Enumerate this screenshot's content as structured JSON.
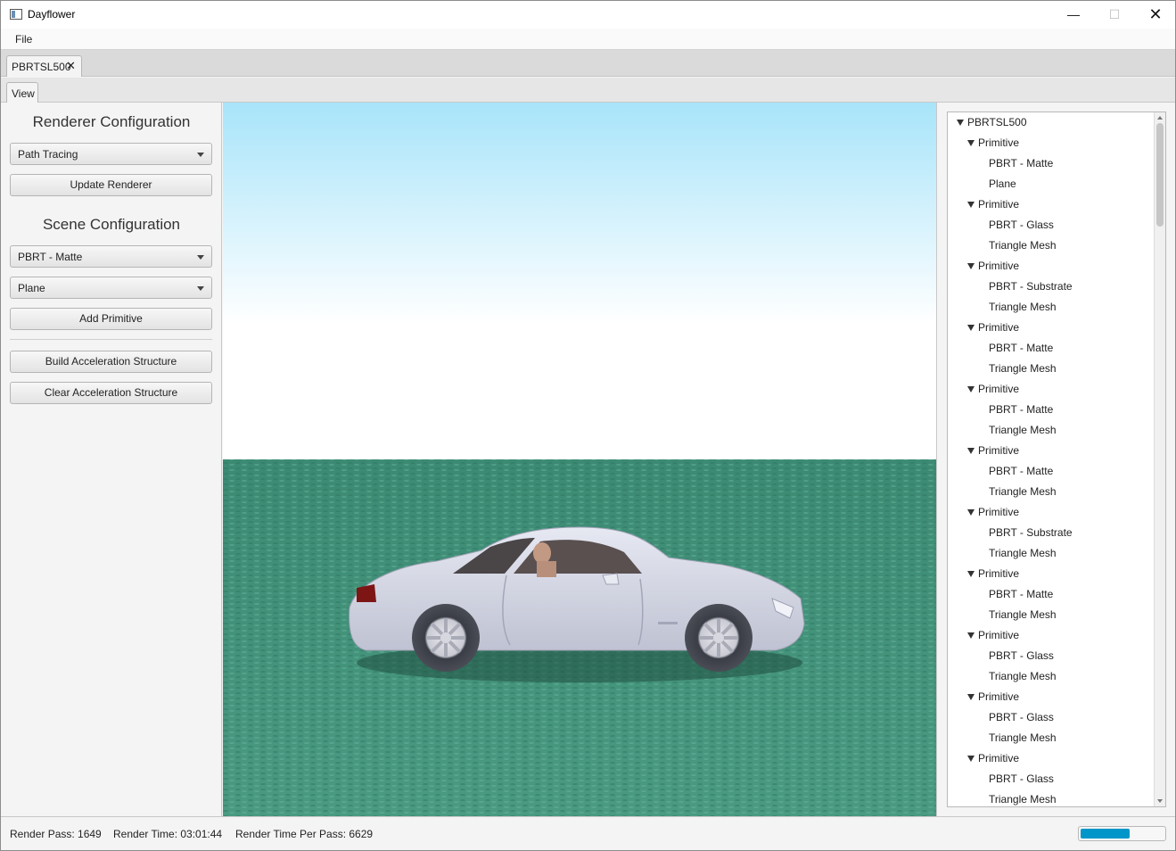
{
  "window": {
    "title": "Dayflower",
    "icons": {
      "app": "window-app-icon",
      "minimize": "minimize-icon",
      "maximize": "maximize-icon",
      "close": "close-icon"
    }
  },
  "menu": {
    "file": "File"
  },
  "document_tab": {
    "label": "PBRTSL500"
  },
  "view_tab": {
    "label": "View"
  },
  "left_panel": {
    "renderer_heading": "Renderer Configuration",
    "renderer_select": "Path Tracing",
    "update_renderer": "Update Renderer",
    "scene_heading": "Scene Configuration",
    "material_select": "PBRT - Matte",
    "shape_select": "Plane",
    "add_primitive": "Add Primitive",
    "build_accel": "Build Acceleration Structure",
    "clear_accel": "Clear Acceleration Structure"
  },
  "viewport": {
    "colors": {
      "sky_top": "#a8e4fa",
      "sky_bottom": "#ffffff",
      "ground": "#3f8e76",
      "car": "#d9dbe8"
    }
  },
  "scene_tree": {
    "root": "PBRTSL500",
    "primitives": [
      {
        "label": "Primitive",
        "material": "PBRT - Matte",
        "shape": "Plane"
      },
      {
        "label": "Primitive",
        "material": "PBRT - Glass",
        "shape": "Triangle Mesh"
      },
      {
        "label": "Primitive",
        "material": "PBRT - Substrate",
        "shape": "Triangle Mesh"
      },
      {
        "label": "Primitive",
        "material": "PBRT - Matte",
        "shape": "Triangle Mesh"
      },
      {
        "label": "Primitive",
        "material": "PBRT - Matte",
        "shape": "Triangle Mesh"
      },
      {
        "label": "Primitive",
        "material": "PBRT - Matte",
        "shape": "Triangle Mesh"
      },
      {
        "label": "Primitive",
        "material": "PBRT - Substrate",
        "shape": "Triangle Mesh"
      },
      {
        "label": "Primitive",
        "material": "PBRT - Matte",
        "shape": "Triangle Mesh"
      },
      {
        "label": "Primitive",
        "material": "PBRT - Glass",
        "shape": "Triangle Mesh"
      },
      {
        "label": "Primitive",
        "material": "PBRT - Glass",
        "shape": "Triangle Mesh"
      },
      {
        "label": "Primitive",
        "material": "PBRT - Glass",
        "shape": "Triangle Mesh"
      }
    ]
  },
  "status": {
    "render_pass": "Render Pass: 1649",
    "render_time": "Render Time: 03:01:44",
    "render_time_per_pass": "Render Time Per Pass: 6629",
    "progress": 0.58,
    "progress_color": "#0096c9"
  }
}
